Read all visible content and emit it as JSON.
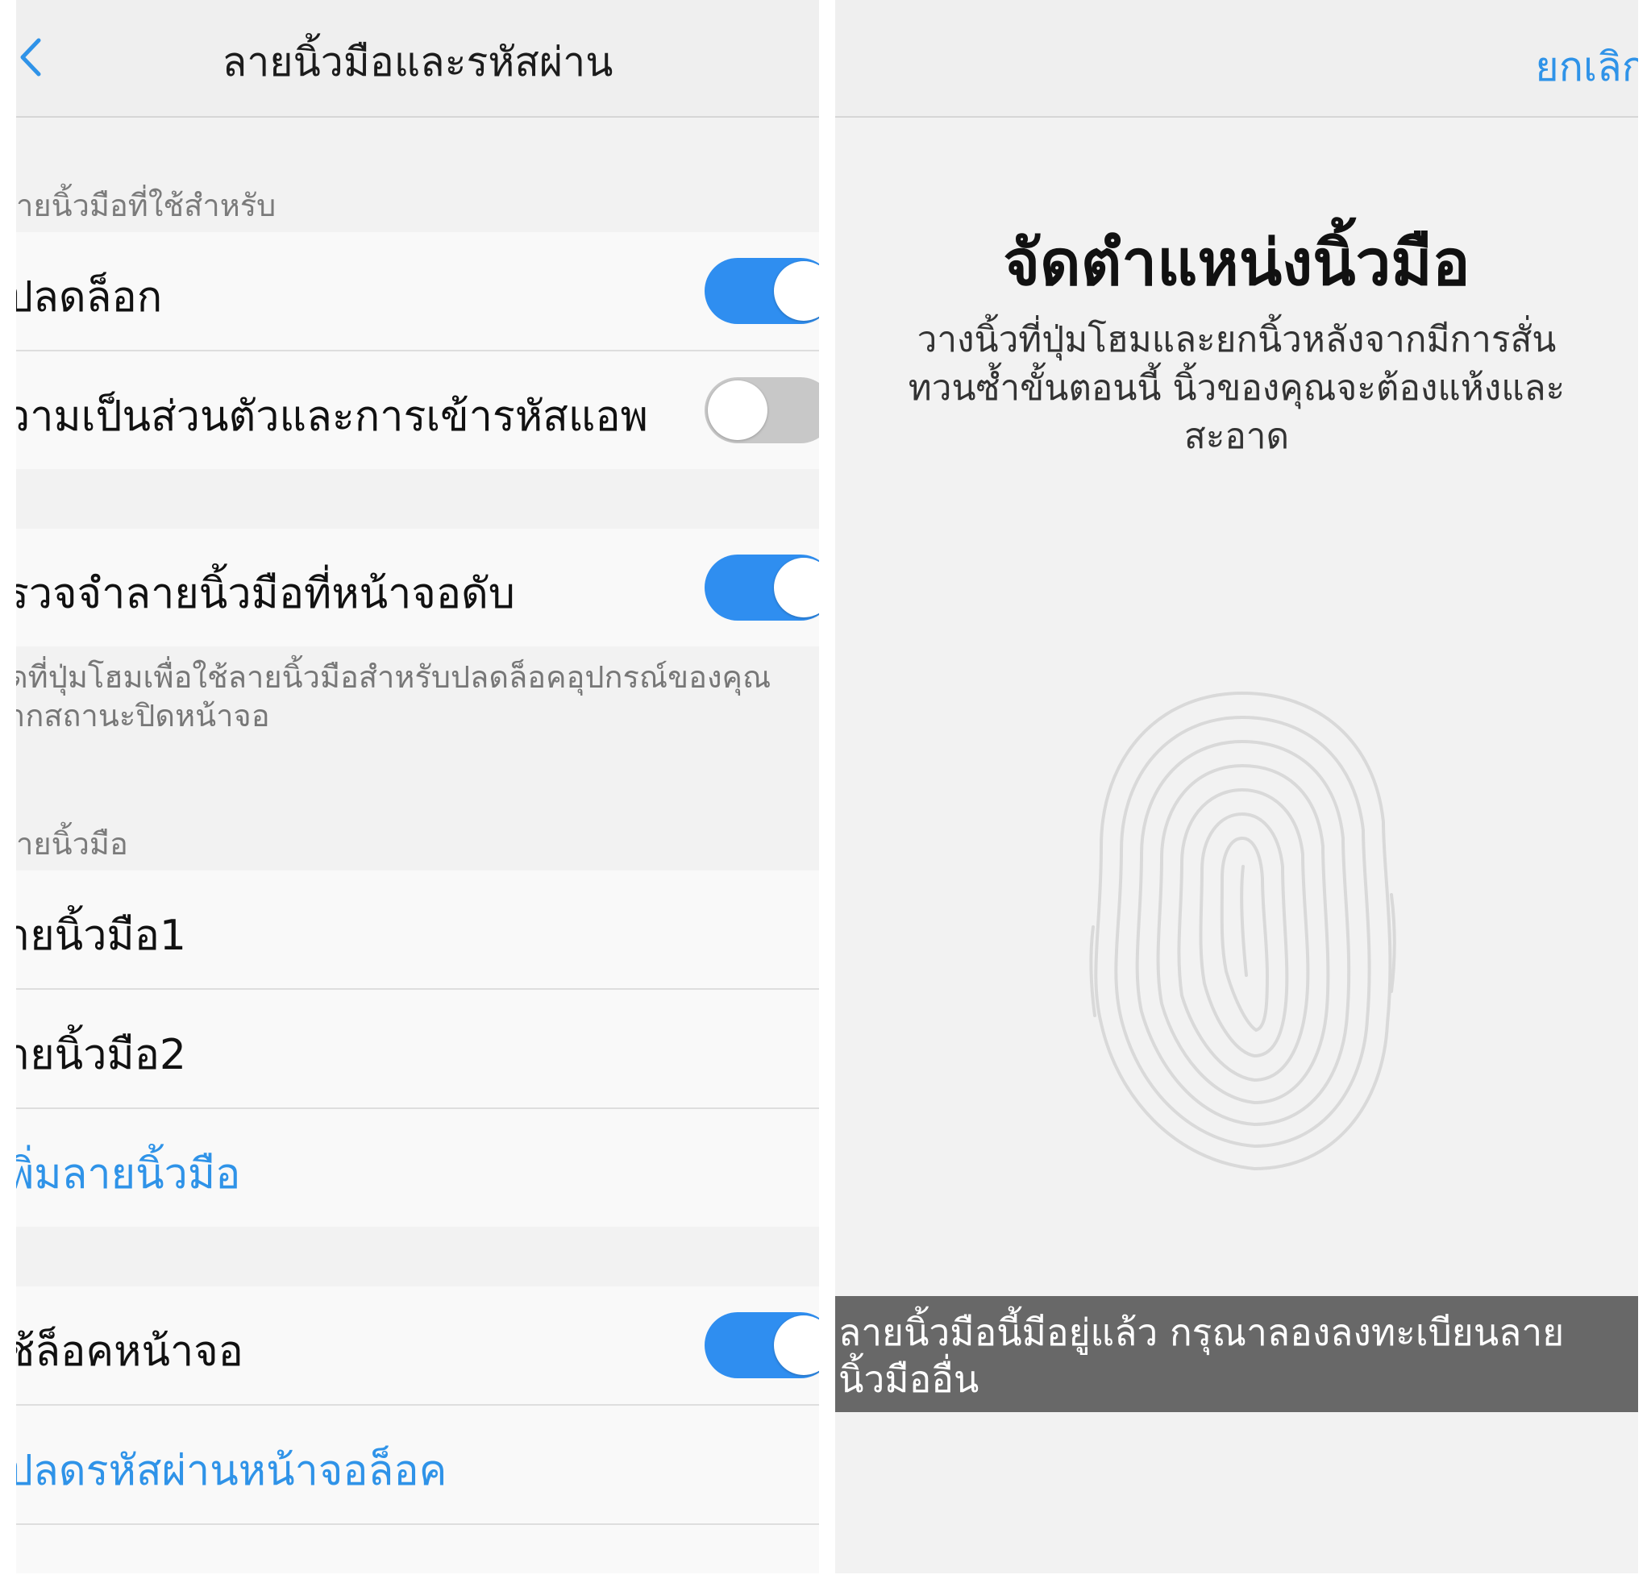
{
  "left_screen": {
    "header": {
      "title": "ลายนิ้วมือและรหัสผ่าน",
      "back_icon": "chevron-left-icon"
    },
    "fingerprint_usage": {
      "section_label": "ายนิ้วมือที่ใช้สำหรับ",
      "unlock": {
        "label": "ปลดล็อก",
        "toggle": "on"
      },
      "privacy_app_encryption": {
        "label": "วามเป็นส่วนตัวและการเข้ารหัสแอพ",
        "toggle": "off"
      }
    },
    "screen_off_recognition": {
      "label": "รวจจำลายนิ้วมือที่หน้าจอดับ",
      "toggle": "on",
      "description_line1": "ดที่ปุ่มโฮมเพื่อใช้ลายนิ้วมือสำหรับปลดล็อคอุปกรณ์ของคุณ",
      "description_line2": "ากสถานะปิดหน้าจอ"
    },
    "fingerprints": {
      "section_label": "ายนิ้วมือ",
      "items": [
        {
          "label": "ายนิ้วมือ1"
        },
        {
          "label": "ายนิ้วมือ2"
        }
      ],
      "add_label": "พิ่มลายนิ้วมือ"
    },
    "screen_lock": {
      "label": "ช้ล็อคหน้าจอ",
      "toggle": "on",
      "change_password_label": "ปลดรหัสผ่านหน้าจอล็อค"
    },
    "accent_color": "#2f93e8",
    "toggle_on_color": "#2f8ef0"
  },
  "right_screen": {
    "cancel_label": "ยกเลิก",
    "title": "จัดตำแหน่งนิ้วมือ",
    "instructions_line1": "วางนิ้วที่ปุ่มโฮมและยกนิ้วหลังจากมีการสั่น",
    "instructions_line2": "ทวนซ้ำขั้นตอนนี้ นิ้วของคุณจะต้องแห้งและ",
    "instructions_line3": "สะอาด",
    "fingerprint_icon": "fingerprint-icon",
    "toast_line1": "ลายนิ้วมือนี้มีอยู่แล้ว กรุณาลองลงทะเบียนลาย",
    "toast_line2": "นิ้วมืออื่น",
    "toast_color": "#686868"
  }
}
